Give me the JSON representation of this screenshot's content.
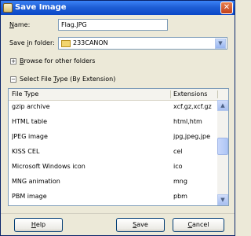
{
  "window": {
    "title": "Save Image"
  },
  "name_field": {
    "label_mnemonic": "N",
    "label_rest": "ame:",
    "value": "Flag.JPG"
  },
  "save_in": {
    "label_pre": "Save ",
    "label_mnemonic": "i",
    "label_rest": "n folder:",
    "value": "233CANON"
  },
  "browse": {
    "label_mnemonic": "B",
    "label_rest": "rowse for other folders"
  },
  "file_type": {
    "label_pre": "Select File ",
    "label_mnemonic": "T",
    "label_rest": "ype (By Extension)"
  },
  "table": {
    "columns": [
      "File Type",
      "Extensions"
    ],
    "rows": [
      {
        "type": "gzip archive",
        "ext": "xcf.gz,xcf.gz"
      },
      {
        "type": "HTML table",
        "ext": "html,htm"
      },
      {
        "type": "JPEG image",
        "ext": "jpg,jpeg,jpe"
      },
      {
        "type": "KISS CEL",
        "ext": "cel"
      },
      {
        "type": "Microsoft Windows icon",
        "ext": "ico"
      },
      {
        "type": "MNG animation",
        "ext": "mng"
      },
      {
        "type": "PBM image",
        "ext": "pbm"
      }
    ]
  },
  "buttons": {
    "help": {
      "mnemonic": "H",
      "rest": "elp"
    },
    "save": {
      "mnemonic": "S",
      "rest": "ave"
    },
    "cancel": {
      "mnemonic": "C",
      "rest": "ancel"
    }
  },
  "icons": {
    "close": "close-icon",
    "folder": "folder-icon",
    "expander_collapsed": "expander-plus-icon",
    "expander_expanded": "expander-minus-icon"
  },
  "colors": {
    "title_bar": "#1f5fd6",
    "close_button": "#c2401b",
    "dialog_bg": "#ece9d8"
  }
}
